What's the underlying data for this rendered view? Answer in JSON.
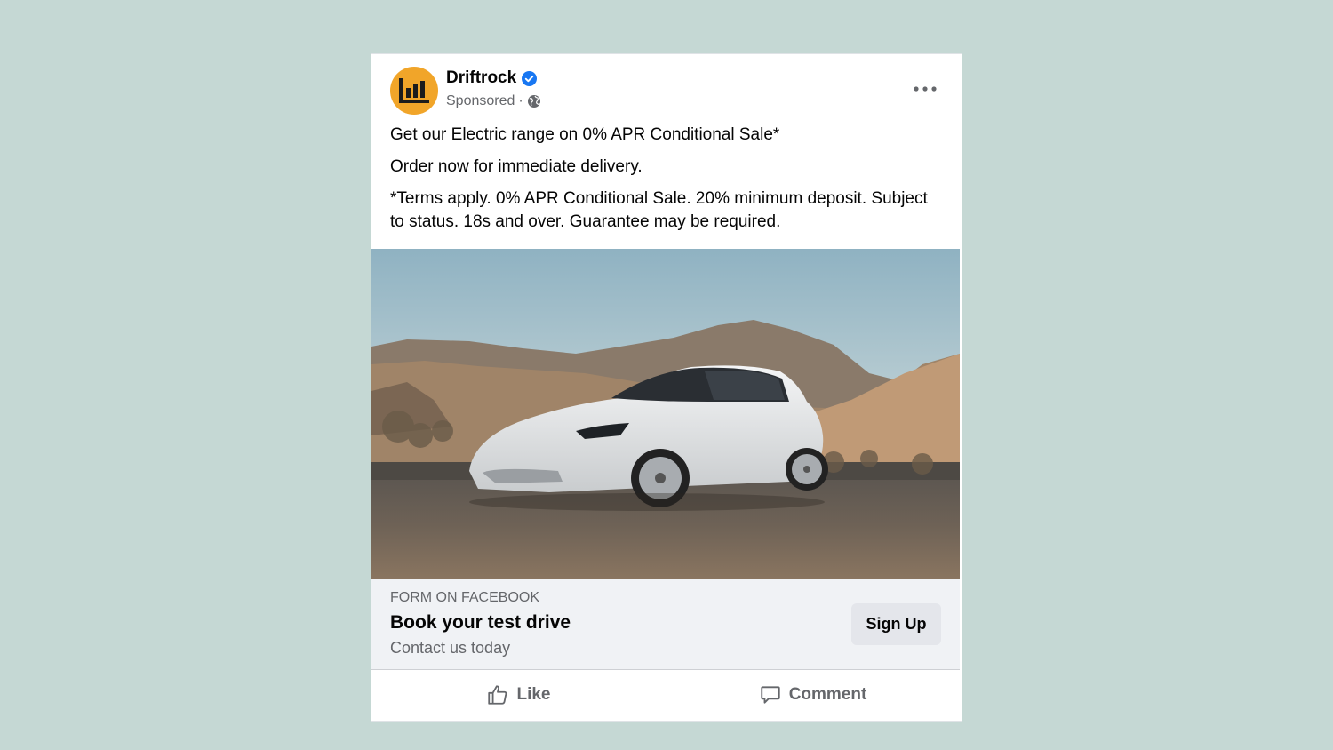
{
  "post": {
    "page_name": "Driftrock",
    "sponsored_label": "Sponsored",
    "separator": "·",
    "text_lines": [
      "Get our Electric range on 0% APR Conditional Sale*",
      "Order now for immediate delivery.",
      "*Terms apply. 0% APR Conditional Sale. 20% minimum deposit. Subject to status. 18s and over. Guarantee may be required."
    ]
  },
  "cta": {
    "source": "FORM ON FACEBOOK",
    "headline": "Book your test drive",
    "description": "Contact us today",
    "button_label": "Sign Up"
  },
  "actions": {
    "like_label": "Like",
    "comment_label": "Comment"
  },
  "icons": {
    "avatar": "driftrock-logo-icon",
    "verified": "verified-badge-icon",
    "privacy": "globe-icon",
    "more": "more-options-icon",
    "like": "thumbs-up-icon",
    "comment": "comment-bubble-icon"
  },
  "colors": {
    "background": "#c5d8d4",
    "avatar": "#f1a529",
    "verified": "#1877f2",
    "cta_bar": "#f0f2f5",
    "button": "#e4e6eb",
    "secondary_text": "#65676b"
  }
}
